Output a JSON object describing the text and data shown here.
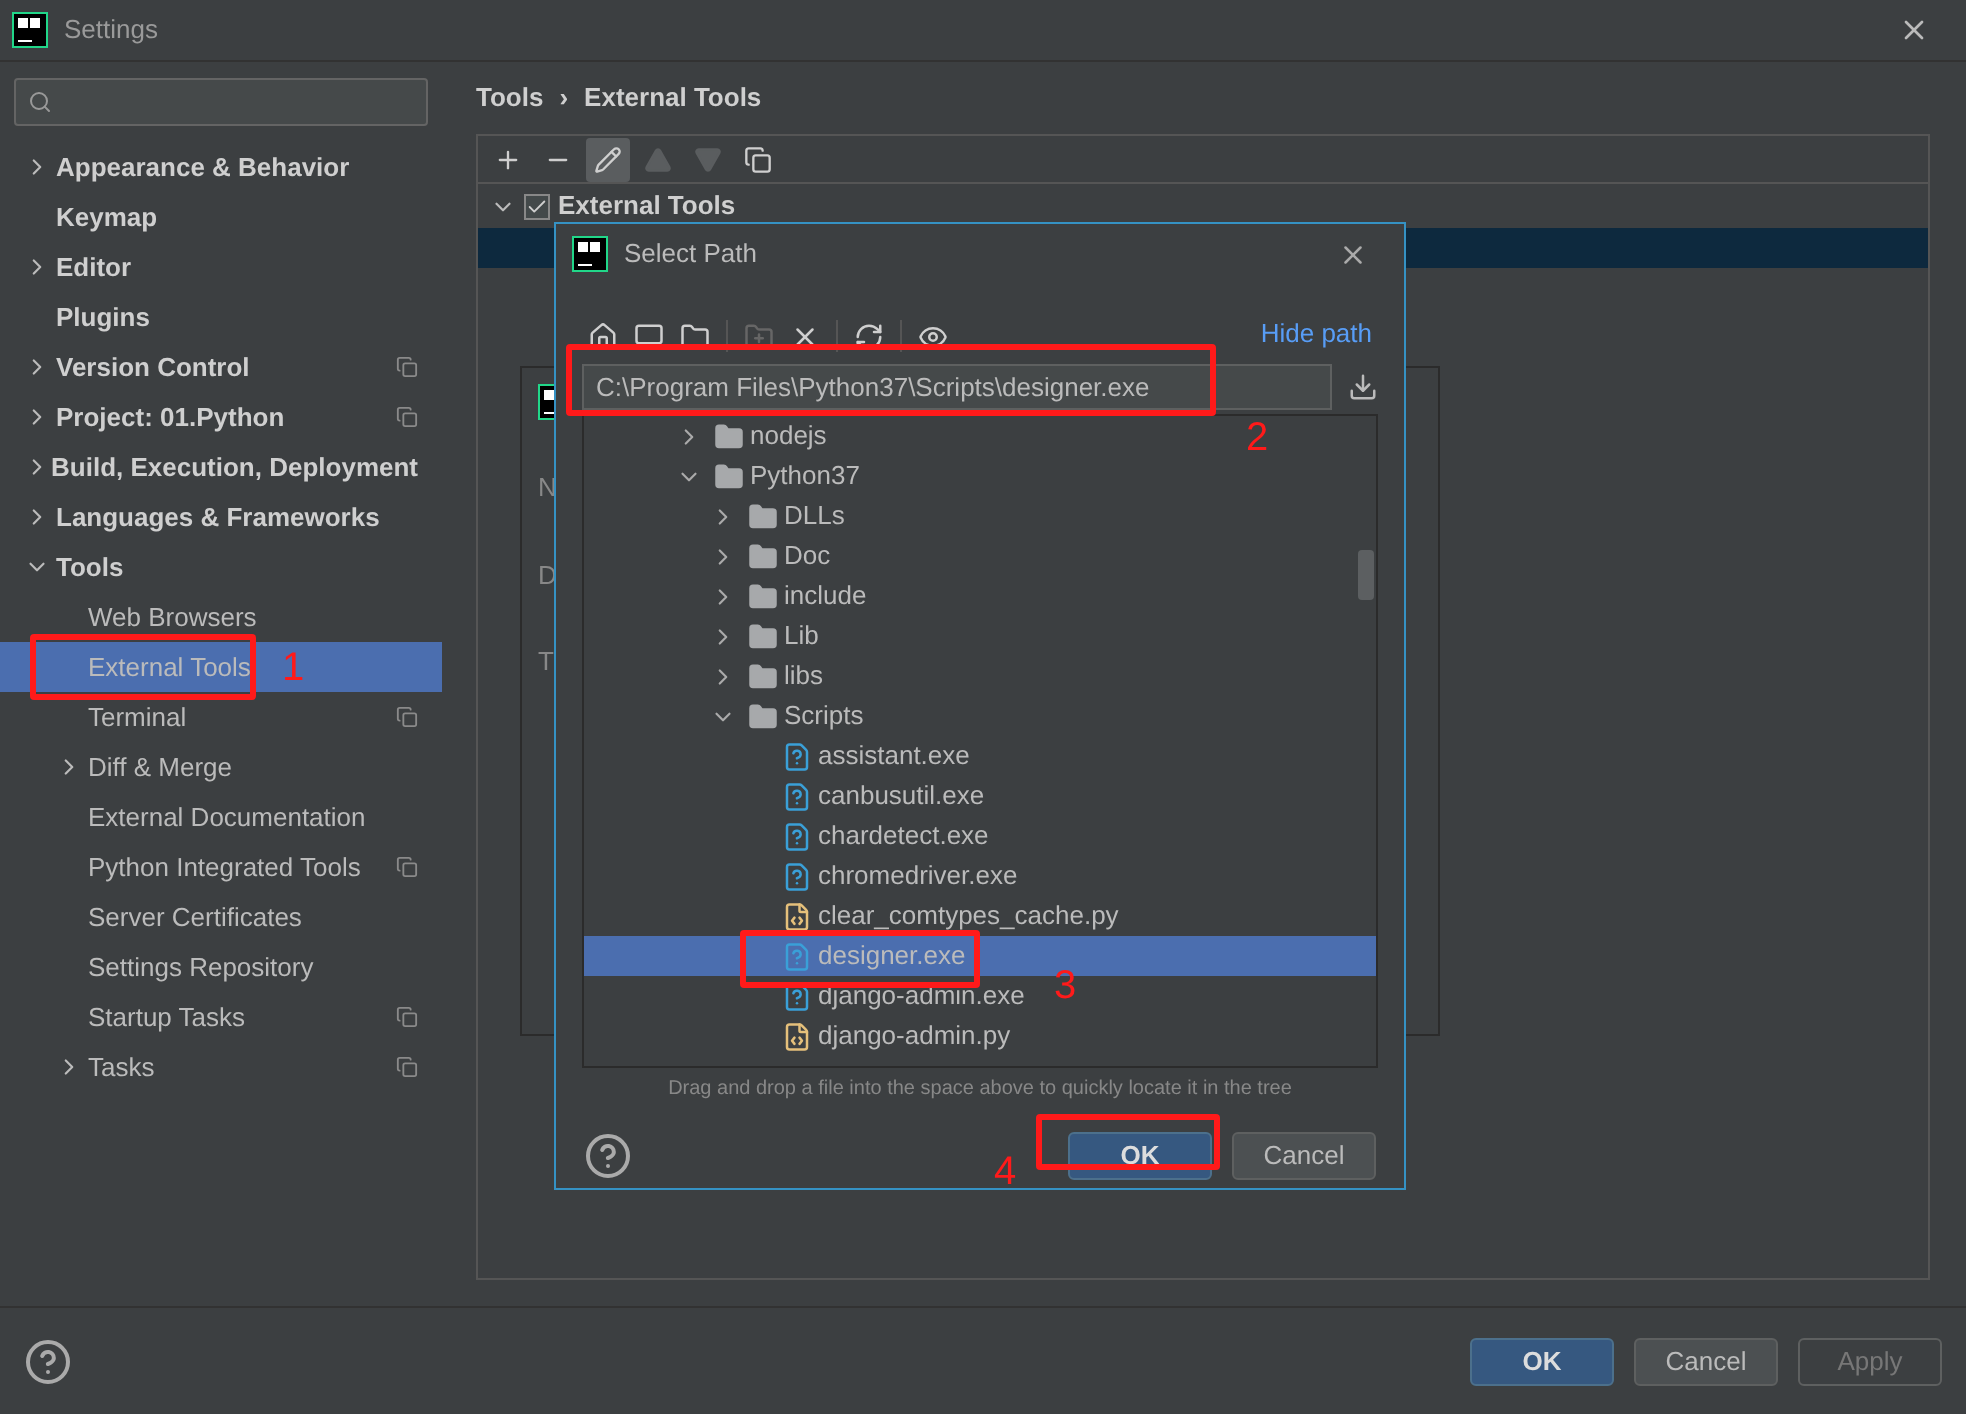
{
  "window": {
    "title": "Settings"
  },
  "sidebar": {
    "items": [
      {
        "label": "Appearance & Behavior",
        "expanded": false,
        "project_scope": false,
        "selected": false
      },
      {
        "label": "Keymap",
        "project_scope": false,
        "selected": false
      },
      {
        "label": "Editor",
        "expanded": false,
        "project_scope": false,
        "selected": false
      },
      {
        "label": "Plugins",
        "project_scope": false,
        "selected": false
      },
      {
        "label": "Version Control",
        "expanded": false,
        "project_scope": true,
        "selected": false
      },
      {
        "label": "Project: 01.Python",
        "expanded": false,
        "project_scope": true,
        "selected": false
      },
      {
        "label": "Build, Execution, Deployment",
        "expanded": false,
        "project_scope": false,
        "selected": false
      },
      {
        "label": "Languages & Frameworks",
        "expanded": false,
        "project_scope": false,
        "selected": false
      },
      {
        "label": "Tools",
        "expanded": true,
        "project_scope": false,
        "selected": false,
        "children": [
          {
            "label": "Web Browsers",
            "project_scope": false,
            "selected": false
          },
          {
            "label": "External Tools",
            "project_scope": false,
            "selected": true
          },
          {
            "label": "Terminal",
            "project_scope": true,
            "selected": false
          },
          {
            "label": "Diff & Merge",
            "expanded": false,
            "project_scope": false,
            "selected": false
          },
          {
            "label": "External Documentation",
            "project_scope": false,
            "selected": false
          },
          {
            "label": "Python Integrated Tools",
            "project_scope": true,
            "selected": false
          },
          {
            "label": "Server Certificates",
            "project_scope": false,
            "selected": false
          },
          {
            "label": "Settings Repository",
            "project_scope": false,
            "selected": false
          },
          {
            "label": "Startup Tasks",
            "project_scope": true,
            "selected": false
          },
          {
            "label": "Tasks",
            "expanded": false,
            "project_scope": true,
            "selected": false
          }
        ]
      }
    ]
  },
  "breadcrumb": [
    "Tools",
    "›",
    "External Tools"
  ],
  "tools_panel": {
    "toolbar": [
      {
        "kind": "add",
        "disabled": false,
        "selected": false
      },
      {
        "kind": "remove",
        "disabled": false,
        "selected": false
      },
      {
        "kind": "edit",
        "disabled": false,
        "selected": true
      },
      {
        "kind": "up",
        "disabled": true,
        "selected": false
      },
      {
        "kind": "down",
        "disabled": true,
        "selected": false
      },
      {
        "kind": "copy",
        "disabled": false,
        "selected": false
      }
    ],
    "group": {
      "label": "External Tools",
      "checked": true,
      "expanded": true
    }
  },
  "back_dialog": {
    "labels": [
      "N",
      "D",
      "T"
    ]
  },
  "select_path": {
    "title": "Select Path",
    "toolbar": [
      {
        "kind": "home",
        "disabled": false
      },
      {
        "kind": "desktop",
        "disabled": false
      },
      {
        "kind": "project",
        "disabled": false
      },
      {
        "kind": "new-folder",
        "disabled": true
      },
      {
        "kind": "delete",
        "disabled": false
      },
      {
        "kind": "refresh",
        "disabled": false
      },
      {
        "kind": "show-hidden",
        "disabled": false
      }
    ],
    "hide_path": "Hide path",
    "path": "C:\\Program Files\\Python37\\Scripts\\designer.exe",
    "tree": [
      {
        "label": "nodejs",
        "kind": "folder",
        "expanded": false,
        "selected": false
      },
      {
        "label": "Python37",
        "kind": "folder",
        "expanded": true,
        "selected": false,
        "children": [
          {
            "label": "DLLs",
            "kind": "folder",
            "expanded": false,
            "selected": false
          },
          {
            "label": "Doc",
            "kind": "folder",
            "expanded": false,
            "selected": false
          },
          {
            "label": "include",
            "kind": "folder",
            "expanded": false,
            "selected": false
          },
          {
            "label": "Lib",
            "kind": "folder",
            "expanded": false,
            "selected": false
          },
          {
            "label": "libs",
            "kind": "folder",
            "expanded": false,
            "selected": false
          },
          {
            "label": "Scripts",
            "kind": "folder",
            "expanded": true,
            "selected": false,
            "children": [
              {
                "label": "assistant.exe",
                "kind": "exe",
                "selected": false
              },
              {
                "label": "canbusutil.exe",
                "kind": "exe",
                "selected": false
              },
              {
                "label": "chardetect.exe",
                "kind": "exe",
                "selected": false
              },
              {
                "label": "chromedriver.exe",
                "kind": "exe",
                "selected": false
              },
              {
                "label": "clear_comtypes_cache.py",
                "kind": "py",
                "selected": false
              },
              {
                "label": "designer.exe",
                "kind": "exe",
                "selected": true
              },
              {
                "label": "django-admin.exe",
                "kind": "exe",
                "selected": false
              },
              {
                "label": "django-admin.py",
                "kind": "py",
                "selected": false
              }
            ]
          }
        ]
      }
    ],
    "hint": "Drag and drop a file into the space above to quickly locate it in the tree",
    "buttons": [
      {
        "label": "OK",
        "default": true
      },
      {
        "label": "Cancel",
        "default": false
      }
    ]
  },
  "buttons": [
    {
      "label": "OK",
      "default": true,
      "disabled": false
    },
    {
      "label": "Cancel",
      "default": false,
      "disabled": false
    },
    {
      "label": "Apply",
      "default": false,
      "disabled": true
    }
  ],
  "annotations": [
    "1",
    "2",
    "3",
    "4"
  ]
}
